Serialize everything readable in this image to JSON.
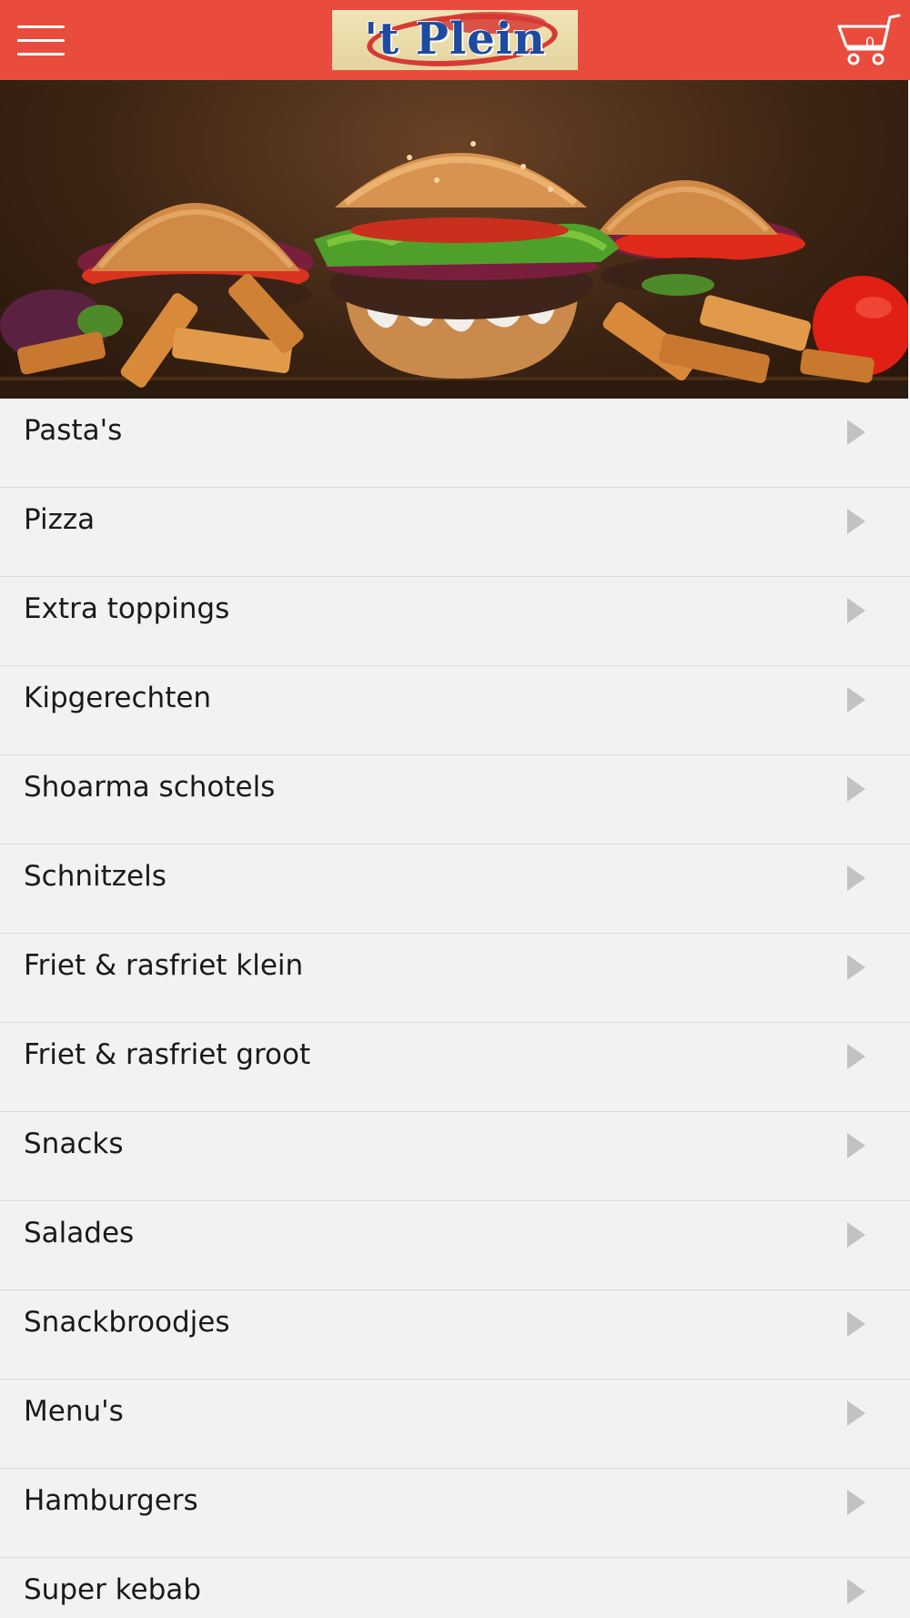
{
  "header": {
    "logo_text": "'t Plein",
    "cart_count": "0",
    "background_color": "#e94c3d"
  },
  "icons": {
    "menu": "hamburger-menu-icon",
    "cart": "shopping-cart-icon",
    "row_arrow": "chevron-right-icon"
  },
  "hero": {
    "image_subject": "burgers-and-fries-banner"
  },
  "menu": {
    "items": [
      {
        "label": "Pasta's"
      },
      {
        "label": "Pizza"
      },
      {
        "label": "Extra toppings"
      },
      {
        "label": "Kipgerechten"
      },
      {
        "label": "Shoarma schotels"
      },
      {
        "label": "Schnitzels"
      },
      {
        "label": "Friet & rasfriet klein"
      },
      {
        "label": "Friet & rasfriet groot"
      },
      {
        "label": "Snacks"
      },
      {
        "label": "Salades"
      },
      {
        "label": "Snackbroodjes"
      },
      {
        "label": "Menu's"
      },
      {
        "label": "Hamburgers"
      },
      {
        "label": "Super kebab"
      }
    ]
  }
}
